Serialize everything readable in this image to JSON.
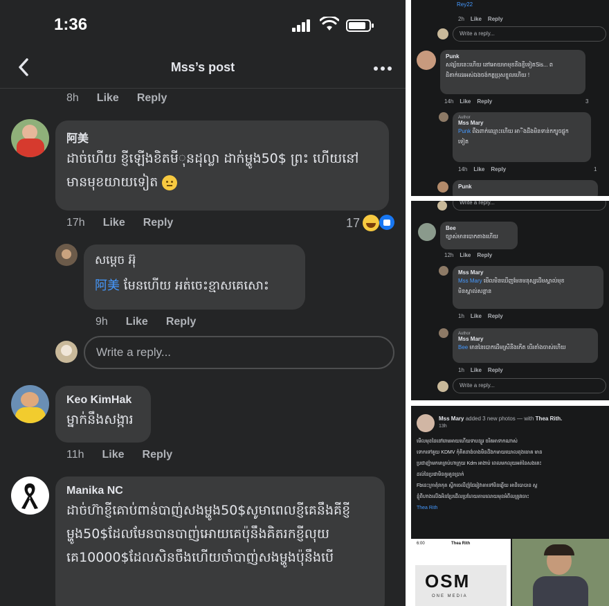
{
  "status_bar": {
    "time": "1:36"
  },
  "header": {
    "title": "Mss’s post"
  },
  "actions": {
    "like": "Like",
    "reply": "Reply"
  },
  "thread": {
    "top_time": "8h",
    "comments": [
      {
        "name": "阿美",
        "text_line1": "ដាច់ហើយ ខ្ញីឡើងខិតមី​ុនដុល្លា ដាក់ម្ហូង50$ ព្រះ ហើយនៅ",
        "text_line2": "មានមុខយាយទៀត",
        "time": "17h",
        "reactions": "17"
      },
      {
        "name": "សម្តេច អ៊ុ",
        "mention": "阿美",
        "text": "មែនហើយ អត់ចេះខ្មាសគេសោះ",
        "time": "9h"
      },
      {
        "name": "Keo KimHak",
        "text": "ម្នាក់នឹងសង្ការ",
        "time": "11h"
      },
      {
        "name": "Manika NC",
        "text_line1": "ដាច់ហ៊ាខ្ញីគោប់ពាន់បាញ់សងម្ហូង50$សូមាពេលខ្ញីគេនឹងគីខ្ញី",
        "text_line2": "ម្ហូង50$ដែលមែនបានបាញ់អោយគេប៉ុនឹងគិតរកខ្ញីលុយ",
        "text_line3": "គេ10000$ដែលសិនចឹងហើយចាំបាញ់សងម្ហូងប៉ុនឹងបើ"
      }
    ],
    "write_reply_placeholder": "Write a reply..."
  },
  "panel_top": {
    "name_top": "Rey22",
    "time_top": "2h",
    "write_reply": "Write a reply...",
    "c1_name": "Punk",
    "c1_line1": "សង្ស័យនេះហើយ នៅអោយមាមុខនឹងខ្ញីទៀតSis... ព",
    "c1_line2": "ដិតាក់ដេរអស់ឯងចង់កត្តប្រុសខ្ទួលហើយ !",
    "c1_time": "14h",
    "c1_reactions": "3",
    "author_badge": "Author",
    "r1_name": "Mss Mary",
    "r1_mention": "Punk",
    "r1_line1": "ពឹងពាក់ឈ្មោះហើយ អាីងដឹងមិនទាន់កក្បូចផ្លូក",
    "r1_line2": "ទៀត",
    "r1_time": "14h",
    "r1_reactions": "1",
    "bottom_name": "Punk"
  },
  "panel_mid": {
    "write_reply": "Write a reply...",
    "c1_name": "Bee",
    "c1_text": "ច្បាស់មានបោកតាងហើយ",
    "c1_time": "12h",
    "author_badge": "Author",
    "r1_name": "Mss Mary",
    "r1_mention": "Mss Mary",
    "r1_line1": "មើលមិនឃើញមែនមនុស្សដើមស្គាល់មុខ",
    "r1_line2": "មិនស្គាល់សន្តាន",
    "r1_time": "1h",
    "r2_name": "Mss Mary",
    "r2_mention": "Bee",
    "r2_text": "មាននៃបោកដើមស្រីនឹងកើត បើរតាំងចាស់ហើយ",
    "r2_time": "1h"
  },
  "panel_post": {
    "author": "Mss Mary",
    "action": "added 3 new photos — with",
    "tagged": "Thea Rith.",
    "time": "13h",
    "line1": "មើលមុខនៃនៅរោមអាយហើយទាបន្សួរ ចរិតអាទាកណាស់",
    "line2": "ទោកទៅគួយ KDMV កុំគិតនាង់ចាងមិនដីងកមាយឃោលពុងចោគ មាន",
    "line3": "ប្រជាញ៉ាមកមាត្រប់ហាក្រុយ Kdm អាងាប់ ពេលមកលុយអត់នៃសងតេះ",
    "line4": "ដល់នៃប្រជាមិនគួរគួនប្រាក់",
    "line5": "Fb​នេះក្រាតុំរាកុត ស្ទីកចេលីញ៉ជែរៀវាតាទៅមិនឆ្ងើយ អានិបោបាន ស្ត",
    "line6": "ខ្ញុំពីហាងលើងអិនប្រែដើលប្រហែយតាបលោយមុខអំពីលត្រូវចោះ",
    "tag_link": "Thea Rith",
    "thumb_time": "6:00",
    "thumb_title": "Thea Rith",
    "thumb_logo": "OSM",
    "thumb_sub": "ONE MEDIA"
  },
  "colors": {
    "background": "#242526",
    "bubble": "#3a3b3c",
    "text": "#e4e6eb",
    "muted": "#b0b3b8",
    "link": "#4599ff",
    "emoji": "#f7c940",
    "like_badge": "#1877f2"
  }
}
